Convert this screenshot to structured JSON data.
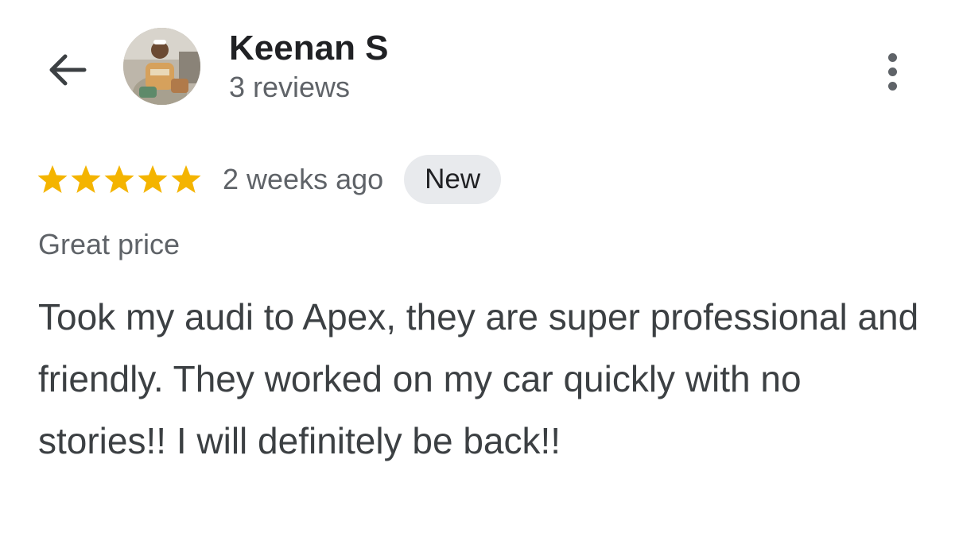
{
  "header": {
    "back_icon": "arrow-left-icon",
    "more_icon": "more-vertical-icon",
    "reviewer": {
      "name": "Keenan S",
      "review_count": "3 reviews",
      "avatar": "avatar-photo"
    }
  },
  "review": {
    "rating": 5,
    "rating_max": 5,
    "star_color": "#f4b400",
    "date": "2 weeks ago",
    "badge": "New",
    "tag": "Great price",
    "text": "Took my audi to Apex, they are super professional and friendly. They worked on my car quickly with no stories!! I will definitely be back!!"
  }
}
